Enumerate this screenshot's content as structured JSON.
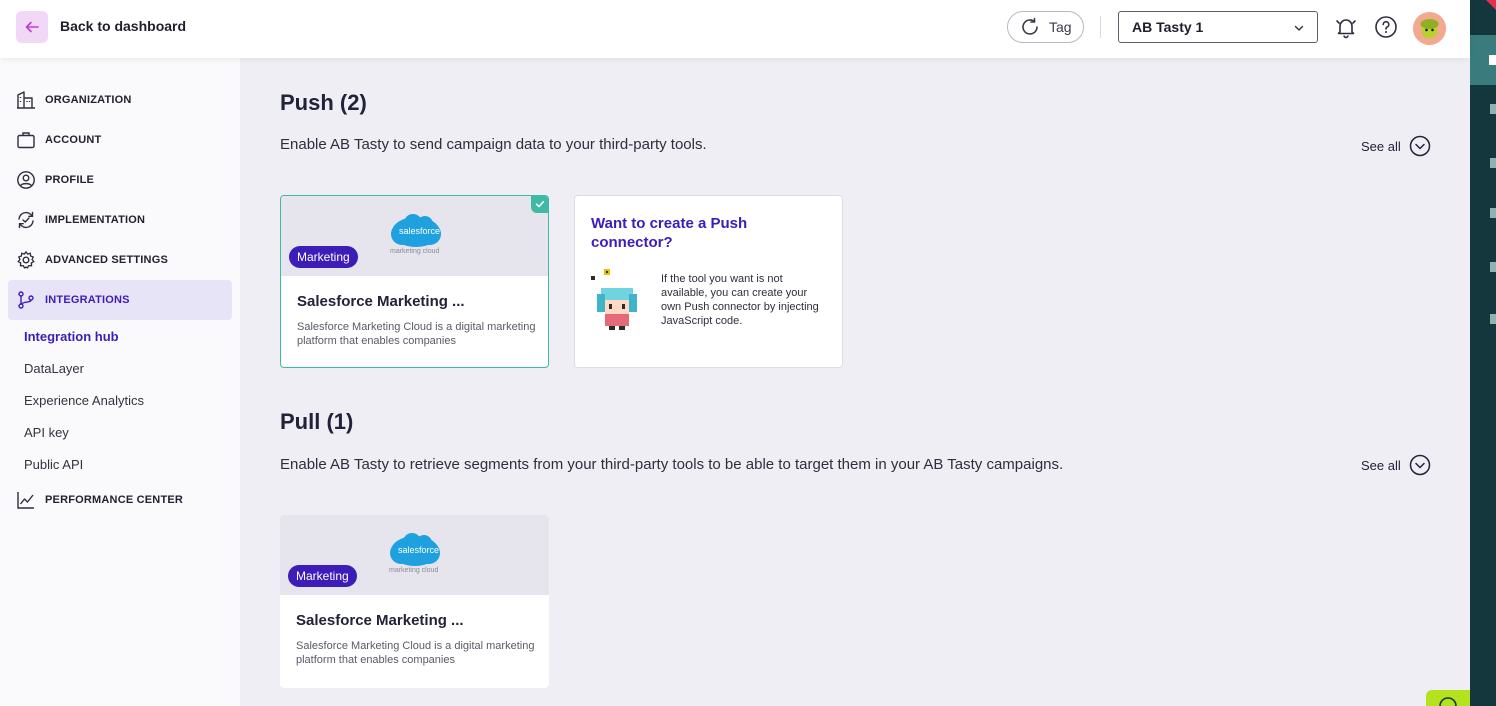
{
  "header": {
    "back_label": "Back to dashboard",
    "tag_label": "Tag",
    "account_selected": "AB Tasty 1"
  },
  "sidebar": {
    "items": [
      {
        "label": "ORGANIZATION"
      },
      {
        "label": "ACCOUNT"
      },
      {
        "label": "PROFILE"
      },
      {
        "label": "IMPLEMENTATION"
      },
      {
        "label": "ADVANCED SETTINGS"
      },
      {
        "label": "INTEGRATIONS"
      },
      {
        "label": "PERFORMANCE CENTER"
      }
    ],
    "sub_items": [
      {
        "label": "Integration hub"
      },
      {
        "label": "DataLayer"
      },
      {
        "label": "Experience Analytics"
      },
      {
        "label": "API key"
      },
      {
        "label": "Public API"
      }
    ]
  },
  "push": {
    "title": "Push (2)",
    "description": "Enable AB Tasty to send campaign data to your third-party tools.",
    "see_all": "See all",
    "card": {
      "badge": "Marketing",
      "logo_text": "salesforce",
      "logo_subtext": "marketing cloud",
      "title": "Salesforce Marketing ...",
      "description": "Salesforce Marketing Cloud is a digital marketing platform that enables companies"
    },
    "promo": {
      "title": "Want to create a Push connector?",
      "text": "If the tool you want is not available, you can create your own Push connector by injecting JavaScript code."
    }
  },
  "pull": {
    "title": "Pull (1)",
    "description": "Enable AB Tasty to retrieve segments from your third-party tools to be able to target them in your AB Tasty campaigns.",
    "see_all": "See all",
    "card": {
      "badge": "Marketing",
      "logo_text": "salesforce",
      "logo_subtext": "marketing cloud",
      "title": "Salesforce Marketing ...",
      "description": "Salesforce Marketing Cloud is a digital marketing platform that enables companies"
    }
  },
  "colors": {
    "accent": "#3c1db8",
    "selected_border": "#3fb8a4",
    "salesforce_blue": "#1fa1e0"
  }
}
